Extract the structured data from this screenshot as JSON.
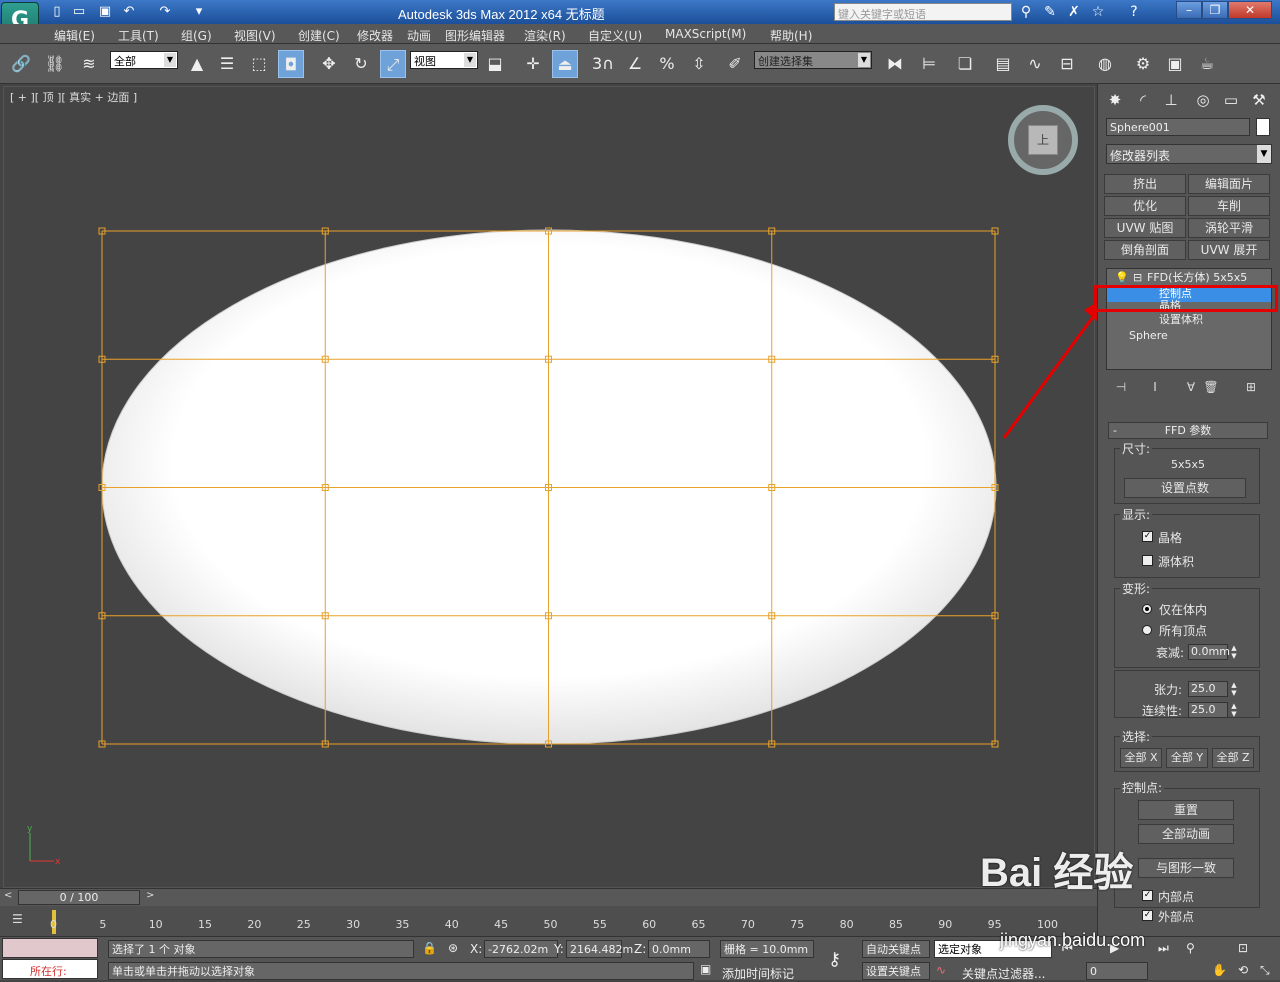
{
  "titlebar": {
    "title": "Autodesk 3ds Max  2012 x64      无标题",
    "search_placeholder": "键入关键字或短语"
  },
  "menu": [
    "编辑(E)",
    "工具(T)",
    "组(G)",
    "视图(V)",
    "创建(C)",
    "修改器",
    "动画",
    "图形编辑器",
    "渲染(R)",
    "自定义(U)",
    "MAXScript(M)",
    "帮助(H)"
  ],
  "toolbar": {
    "selection_filter": "全部",
    "ref_coord": "视图",
    "named_selection": "创建选择集"
  },
  "viewport": {
    "label": "[ + ][ 顶 ][ 真实 + 边面 ]",
    "viewcube_face": "上",
    "accent_color": "#e8a12a"
  },
  "command_panel": {
    "object_name": "Sphere001",
    "modifier_list": "修改器列表",
    "modifier_buttons": [
      "挤出",
      "编辑面片",
      "优化",
      "车削",
      "UVW 贴图",
      "涡轮平滑",
      "倒角剖面",
      "UVW 展开"
    ],
    "stack": {
      "modifier": "FFD(长方体) 5x5x5",
      "sub_items": [
        "控制点",
        "晶格",
        "设置体积"
      ],
      "base": "Sphere"
    },
    "ffd": {
      "rollout_title": "FFD 参数",
      "dimensions_label": "尺寸:",
      "dimensions_value": "5x5x5",
      "set_points_button": "设置点数",
      "display_label": "显示:",
      "lattice_label": "晶格",
      "lattice_checked": true,
      "source_volume_label": "源体积",
      "source_volume_checked": false,
      "deform_label": "变形:",
      "only_in_volume": "仅在体内",
      "all_vertices": "所有顶点",
      "falloff_label": "衰减:",
      "falloff_value": "0.0mm",
      "tension_label": "张力:",
      "tension_value": "25.0",
      "continuity_label": "连续性:",
      "continuity_value": "25.0",
      "select_label": "选择:",
      "select_x": "全部 X",
      "select_y": "全部 Y",
      "select_z": "全部 Z",
      "control_points_label": "控制点:",
      "reset_button": "重置",
      "animate_all_button": "全部动画",
      "conform_button": "与图形一致",
      "inner_points": "内部点",
      "outer_points": "外部点"
    }
  },
  "timeline": {
    "slider": "0 / 100",
    "ticks": [
      "0",
      "5",
      "10",
      "15",
      "20",
      "25",
      "30",
      "35",
      "40",
      "45",
      "50",
      "55",
      "60",
      "65",
      "70",
      "75",
      "80",
      "85",
      "90",
      "95",
      "100"
    ]
  },
  "status": {
    "selected": "选择了 1 个 对象",
    "prompt": "单击或单击并拖动以选择对象",
    "running": "所在行:",
    "x_label": "X:",
    "x_value": "-2762.02m",
    "y_label": "Y:",
    "y_value": "2164.482m",
    "z_label": "Z:",
    "z_value": "0.0mm",
    "grid": "栅格 = 10.0mm",
    "auto_key": "自动关键点",
    "set_key": "设置关键点",
    "key_target": "选定对象",
    "key_filters": "关键点过滤器...",
    "add_time_tag": "添加时间标记",
    "frame_value": "0"
  },
  "watermark": {
    "brand": "Bai 经验",
    "url": "jingyan.baidu.com"
  }
}
